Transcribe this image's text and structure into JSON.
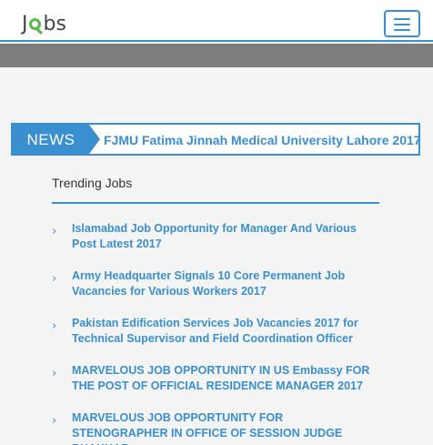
{
  "header": {
    "logo_text_left": "J",
    "logo_text_right": "bs",
    "menu_icon": "hamburger-icon"
  },
  "news": {
    "label": "NEWS",
    "ticker": "FJMU Fatima Jinnah Medical University Lahore 2017 |"
  },
  "trending": {
    "title": "Trending Jobs",
    "jobs": [
      {
        "title": "Islamabad Job Opportunity for Manager And Various Post Latest 2017"
      },
      {
        "title": "Army Headquarter Signals 10 Core Permanent Job Vacancies for Various Workers 2017"
      },
      {
        "title": "Pakistan Edification Services Job Vacancies 2017 for Technical Supervisor and Field Coordination Officer"
      },
      {
        "title": "MARVELOUS JOB OPPORTUNITY IN US Embassy FOR THE POST OF OFFICIAL RESIDENCE MANAGER 2017"
      },
      {
        "title": "MARVELOUS JOB OPPORTUNITY FOR STENOGRAPHER IN OFFICE OF SESSION JUDGE BHAKKAR"
      }
    ]
  },
  "colors": {
    "accent": "#3a8fd0",
    "logo_green": "#58b94a",
    "band_gray": "#7d7d7d"
  }
}
